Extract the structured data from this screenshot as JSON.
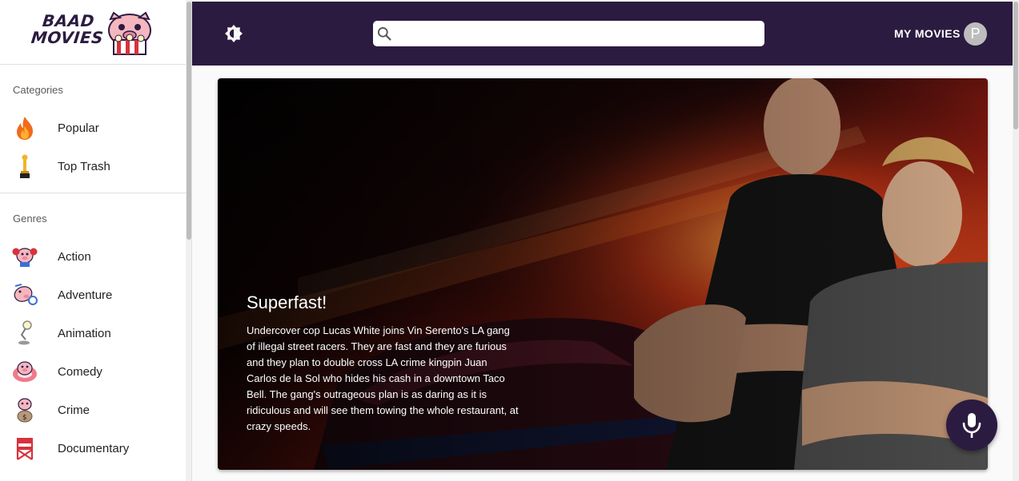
{
  "logo": {
    "line1": "BAAD",
    "line2": "MOVIES"
  },
  "sidebar": {
    "categories_title": "Categories",
    "categories": [
      {
        "label": "Popular",
        "icon": "fire-icon"
      },
      {
        "label": "Top Trash",
        "icon": "trophy-icon"
      }
    ],
    "genres_title": "Genres",
    "genres": [
      {
        "label": "Action",
        "icon": "boxing-pig-icon"
      },
      {
        "label": "Adventure",
        "icon": "adventure-pig-icon"
      },
      {
        "label": "Animation",
        "icon": "lamp-icon"
      },
      {
        "label": "Comedy",
        "icon": "comedy-pig-icon"
      },
      {
        "label": "Crime",
        "icon": "money-bag-pig-icon"
      },
      {
        "label": "Documentary",
        "icon": "directors-chair-icon"
      }
    ]
  },
  "header": {
    "search_placeholder": "",
    "my_movies_label": "MY MOVIES",
    "avatar_initial": "P"
  },
  "hero": {
    "title": "Superfast!",
    "description": "Undercover cop Lucas White joins Vin Serento's LA gang of illegal street racers. They are fast and they are furious and they plan to double cross LA crime kingpin Juan Carlos de la Sol who hides his cash in a downtown Taco Bell. The gang's outrageous plan is as daring as it is ridiculous and will see them towing the whole restaurant, at crazy speeds."
  },
  "colors": {
    "header_bg": "#2c1b40",
    "accent": "#2c1b40"
  }
}
